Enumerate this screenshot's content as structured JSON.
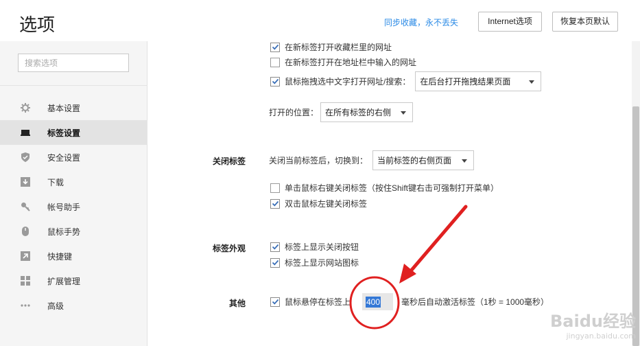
{
  "header": {
    "title": "选项",
    "sync_link": "同步收藏，永不丢失",
    "internet_btn": "Internet选项",
    "restore_btn": "恢复本页默认"
  },
  "sidebar": {
    "search_placeholder": "搜索选项",
    "items": [
      {
        "label": "基本设置",
        "icon": "gear-icon"
      },
      {
        "label": "标签设置",
        "icon": "tab-icon",
        "active": true
      },
      {
        "label": "安全设置",
        "icon": "shield-icon"
      },
      {
        "label": "下载",
        "icon": "download-icon"
      },
      {
        "label": "帐号助手",
        "icon": "key-icon"
      },
      {
        "label": "鼠标手势",
        "icon": "mouse-icon"
      },
      {
        "label": "快捷键",
        "icon": "shortcut-icon"
      },
      {
        "label": "扩展管理",
        "icon": "extensions-icon"
      },
      {
        "label": "高级",
        "icon": "more-icon"
      }
    ]
  },
  "content": {
    "open": {
      "opt1": "在新标签打开收藏栏里的网址",
      "opt2": "在新标签打开在地址栏中输入的网址",
      "opt3": "鼠标拖拽选中文字打开网址/搜索：",
      "opt3_select": "在后台打开拖拽结果页面",
      "position_label": "打开的位置：",
      "position_select": "在所有标签的右侧"
    },
    "close": {
      "label": "关闭标签",
      "switch_label": "关闭当前标签后，切换到：",
      "switch_select": "当前标签的右侧页面",
      "opt1": "单击鼠标右键关闭标签（按住Shift键右击可强制打开菜单）",
      "opt2": "双击鼠标左键关闭标签"
    },
    "appearance": {
      "label": "标签外观",
      "opt1": "标签上显示关闭按钮",
      "opt2": "标签上显示网站图标"
    },
    "other": {
      "label": "其他",
      "prefix": "鼠标悬停在标签上",
      "value": "400",
      "suffix": "毫秒后自动激活标签（1秒 = 1000毫秒）"
    }
  },
  "checkboxes": {
    "open_opt1": true,
    "open_opt2": false,
    "open_opt3": true,
    "close_opt1": false,
    "close_opt2": true,
    "appearance_opt1": true,
    "appearance_opt2": true,
    "other_hover": true
  },
  "annotation_color": "#e02020",
  "watermark": {
    "brand": "Baidu经验",
    "url": "jingyan.baidu.com"
  }
}
